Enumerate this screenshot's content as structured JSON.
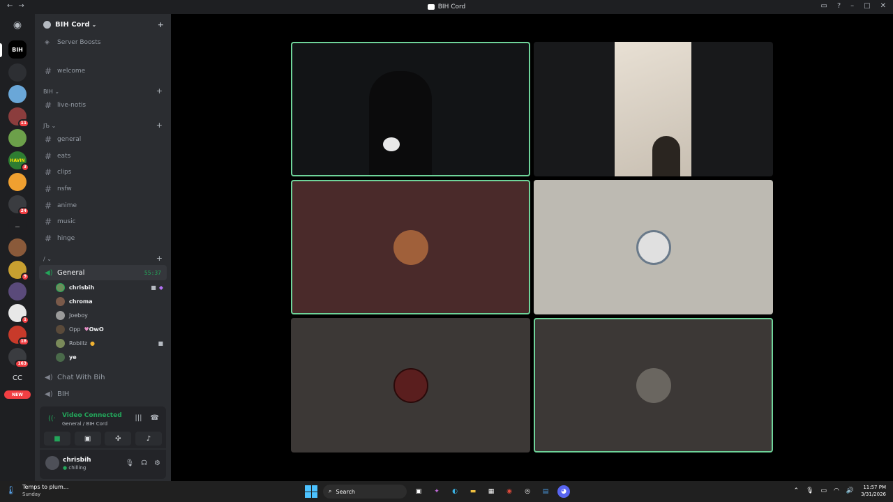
{
  "titlebar": {
    "title": "BIH Cord"
  },
  "server": {
    "name": "BIH Cord",
    "boosts_label": "Server Boosts"
  },
  "channels": {
    "top": [
      {
        "name": "welcome"
      }
    ],
    "cat_bih": {
      "label": "BIH",
      "items": [
        {
          "name": "live-notis"
        }
      ]
    },
    "cat_jb": {
      "label": "JЪ",
      "items": [
        {
          "name": "general"
        },
        {
          "name": "eats"
        },
        {
          "name": "clips"
        },
        {
          "name": "nsfw"
        },
        {
          "name": "anime"
        },
        {
          "name": "music"
        },
        {
          "name": "hinge"
        }
      ]
    },
    "cat_slash": {
      "label": "/"
    }
  },
  "voice": {
    "active_channel": "General",
    "timer": "55:37",
    "members": [
      {
        "name": "chrisbih",
        "bold": true
      },
      {
        "name": "chroma",
        "bold": true
      },
      {
        "name": "Joeboy",
        "bold": false
      },
      {
        "name": "Opp",
        "bold": false,
        "tag": "OwO"
      },
      {
        "name": "Robillz",
        "bold": false
      },
      {
        "name": "ye",
        "bold": true
      }
    ],
    "other_channels": [
      {
        "name": "Chat With Bih"
      },
      {
        "name": "BIH"
      }
    ]
  },
  "voice_status": {
    "title": "Video Connected",
    "subtitle": "General / BIH Cord"
  },
  "user": {
    "name": "chrisbih",
    "status": "chilling"
  },
  "guild_badges": [
    "11",
    "3",
    "24",
    "9",
    "1",
    "18",
    "163"
  ],
  "guild_labels": {
    "cc": "CC",
    "new": "NEW",
    "havin": "HAVIN",
    "bih": "BIH"
  },
  "taskbar": {
    "weather_title": "Temps to plum...",
    "weather_sub": "Sunday",
    "search_label": "Search",
    "time": "11:57 PM",
    "date": "3/31/2026"
  },
  "colors": {
    "accent_green": "#23a55a",
    "speaking_border": "#6fd49a",
    "tile_maroon": "#4a2a2a",
    "tile_gray": "#bdbab2",
    "tile_dark": "#3c3836"
  }
}
